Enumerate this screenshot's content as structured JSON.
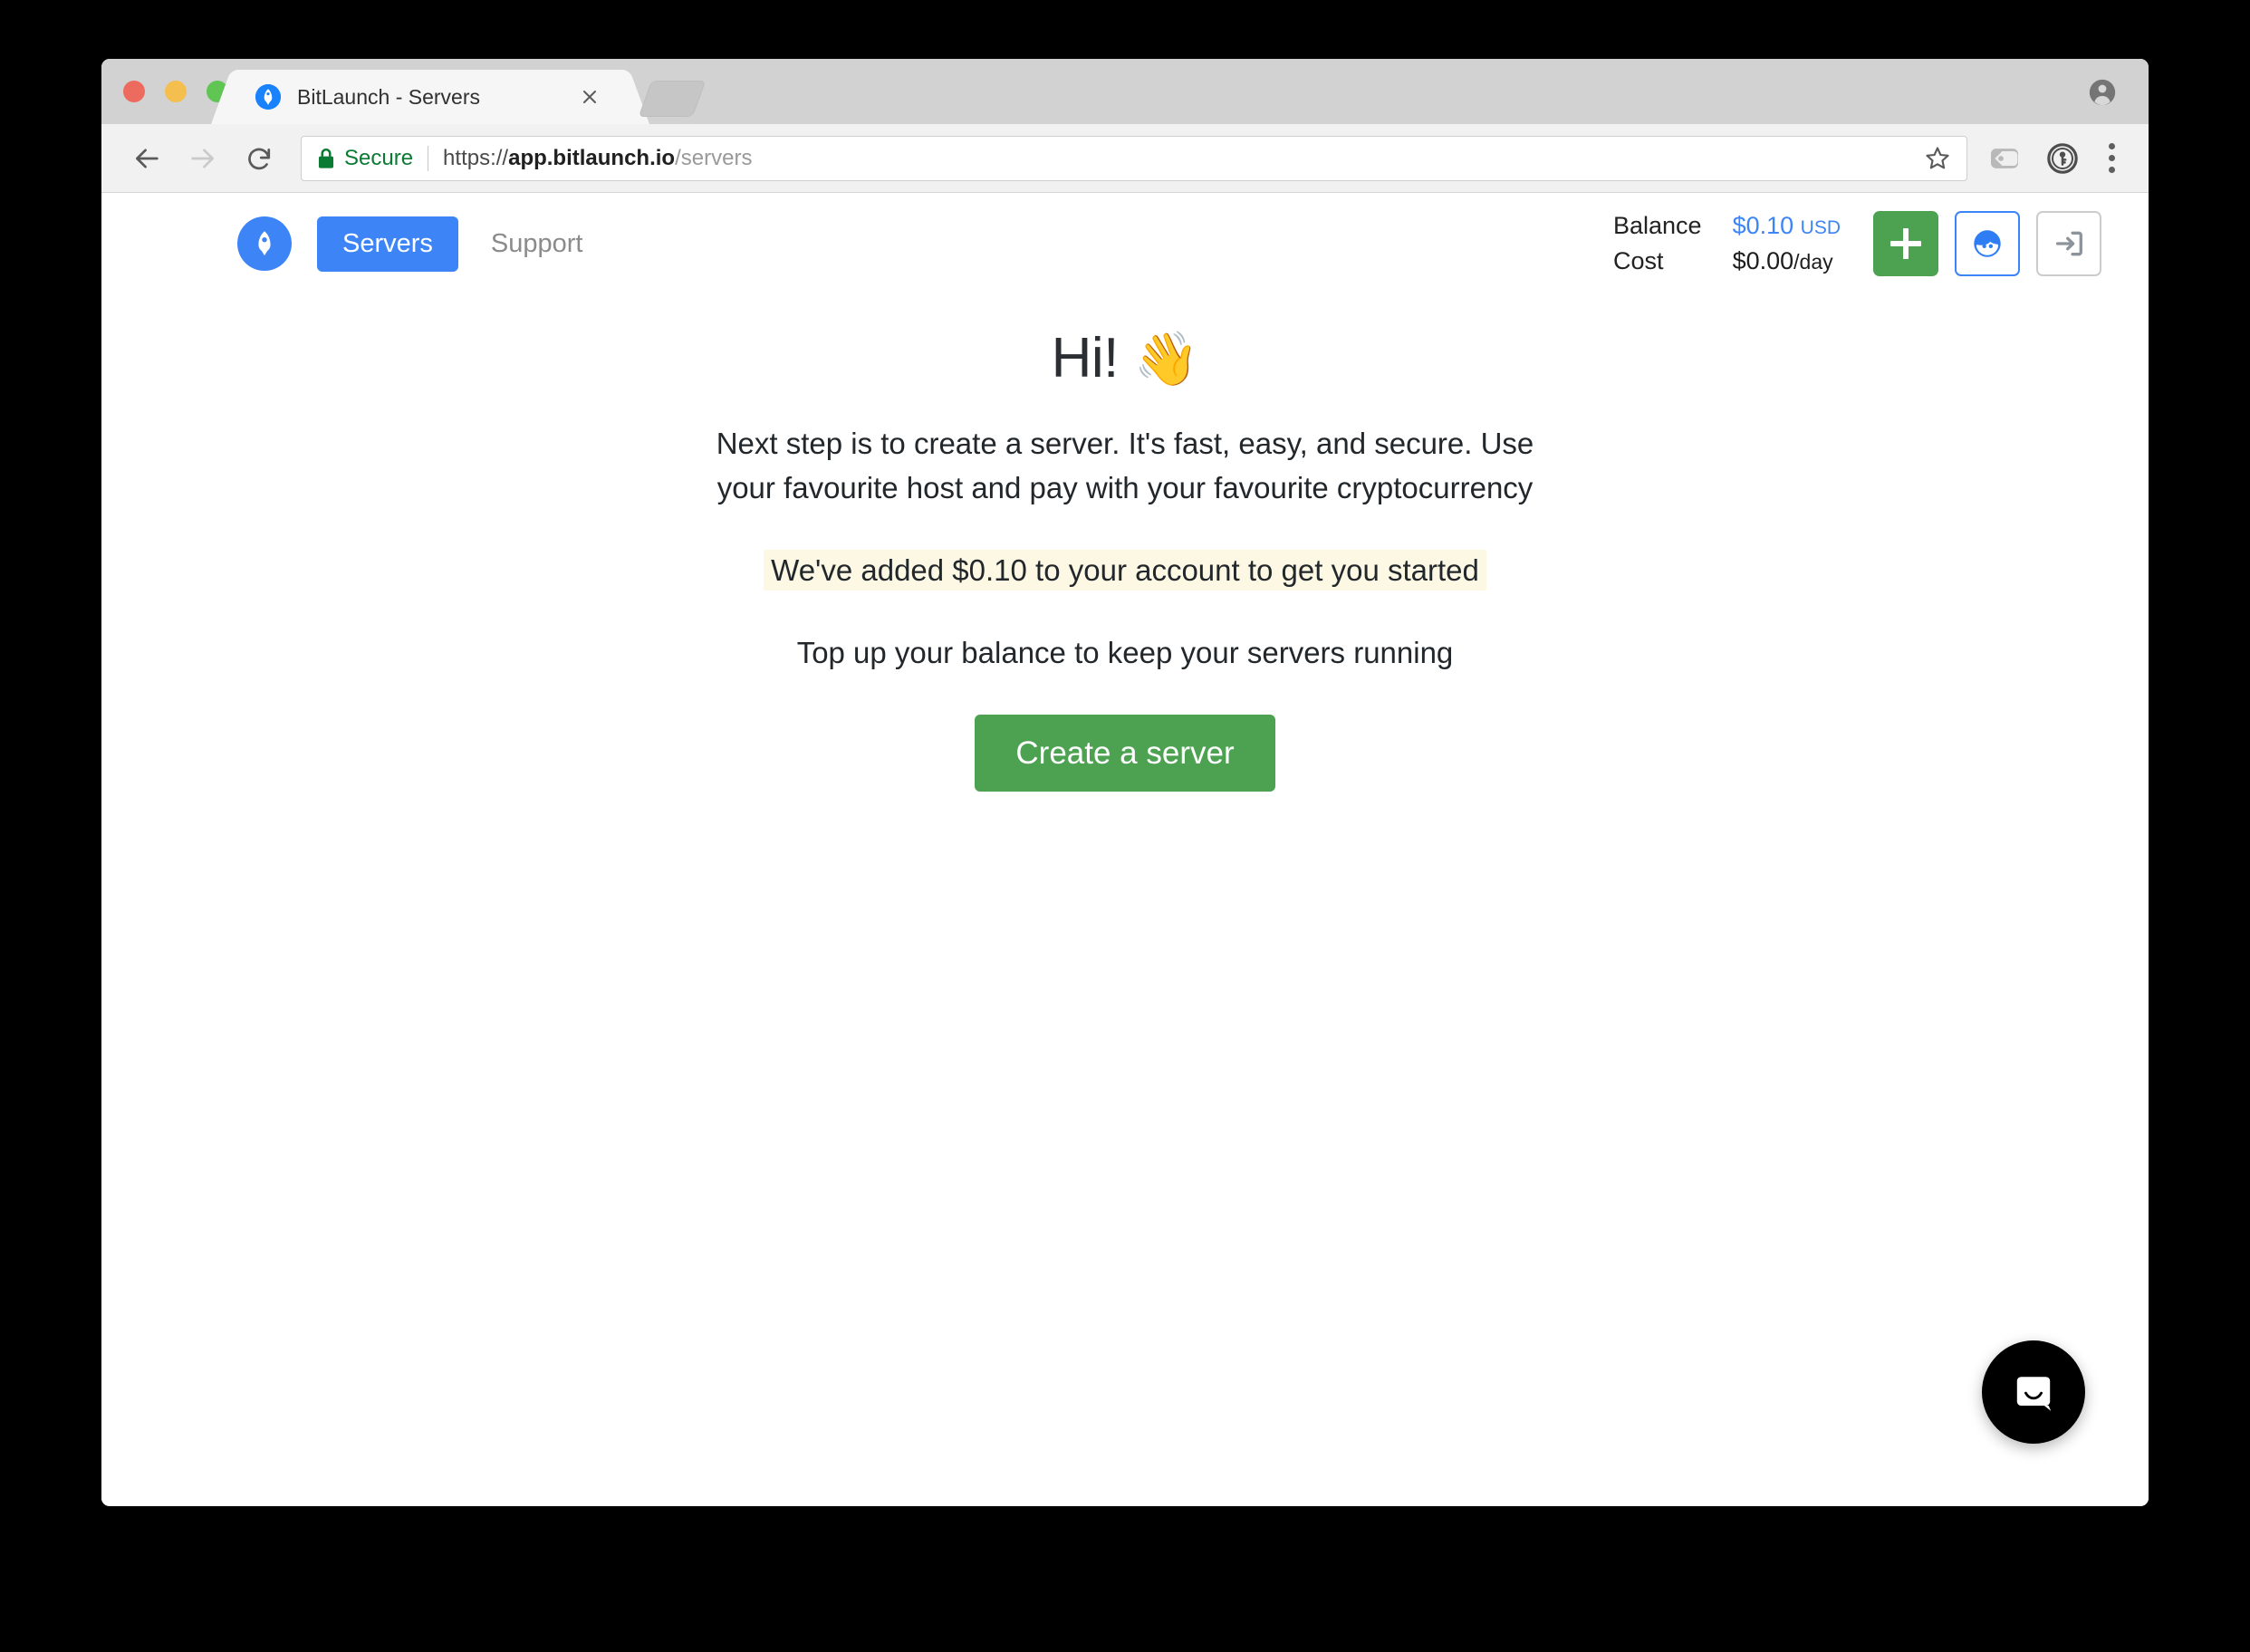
{
  "window": {
    "traffic_lights": [
      "close",
      "minimize",
      "zoom"
    ],
    "profile_icon": "person-avatar-icon"
  },
  "tab": {
    "favicon": "bitlaunch-rocket-favicon",
    "title": "BitLaunch - Servers",
    "close_label": "×",
    "new_tab_label": "New Tab"
  },
  "toolbar": {
    "back_label": "Back",
    "forward_label": "Forward",
    "reload_label": "Reload",
    "security_label": "Secure",
    "url": {
      "scheme": "https://",
      "host": "app.bitlaunch.io",
      "path": "/servers",
      "full": "https://app.bitlaunch.io/servers"
    },
    "bookmark_label": "Bookmark this page",
    "extensions": [
      "tag-extension-icon",
      "password-manager-icon"
    ],
    "menu_label": "Customize and control Google Chrome"
  },
  "app_header": {
    "logo": "bitlaunch-rocket-logo",
    "nav": [
      {
        "label": "Servers",
        "active": true
      },
      {
        "label": "Support",
        "active": false
      }
    ],
    "balance_label": "Balance",
    "balance_value": "$0.10",
    "balance_currency": "USD",
    "cost_label": "Cost",
    "cost_value": "$0.00",
    "cost_period": "/day",
    "actions": [
      {
        "name": "add-funds",
        "icon": "plus-icon",
        "label": "+"
      },
      {
        "name": "account",
        "icon": "user-face-icon",
        "label": "Account"
      },
      {
        "name": "logout",
        "icon": "logout-icon",
        "label": "Log out"
      }
    ]
  },
  "main": {
    "greeting": "Hi!",
    "greeting_emoji": "👋",
    "intro": "Next step is to create a server. It's fast, easy, and secure. Use your favourite host and pay with your favourite cryptocurrency",
    "credit_message": "We've added $0.10 to your account to get you started",
    "topup_message": "Top up your balance to keep your servers running",
    "cta_label": "Create a server"
  },
  "chat": {
    "launcher_label": "Open Intercom Messenger",
    "icon": "chat-bubble-smile-icon"
  },
  "colors": {
    "brand_blue": "#3d85f7",
    "accent_green": "#4ca250",
    "highlight_cream": "#fcf8e3",
    "secure_green": "#0b7b33",
    "muted_gray": "#8b8b8b"
  }
}
